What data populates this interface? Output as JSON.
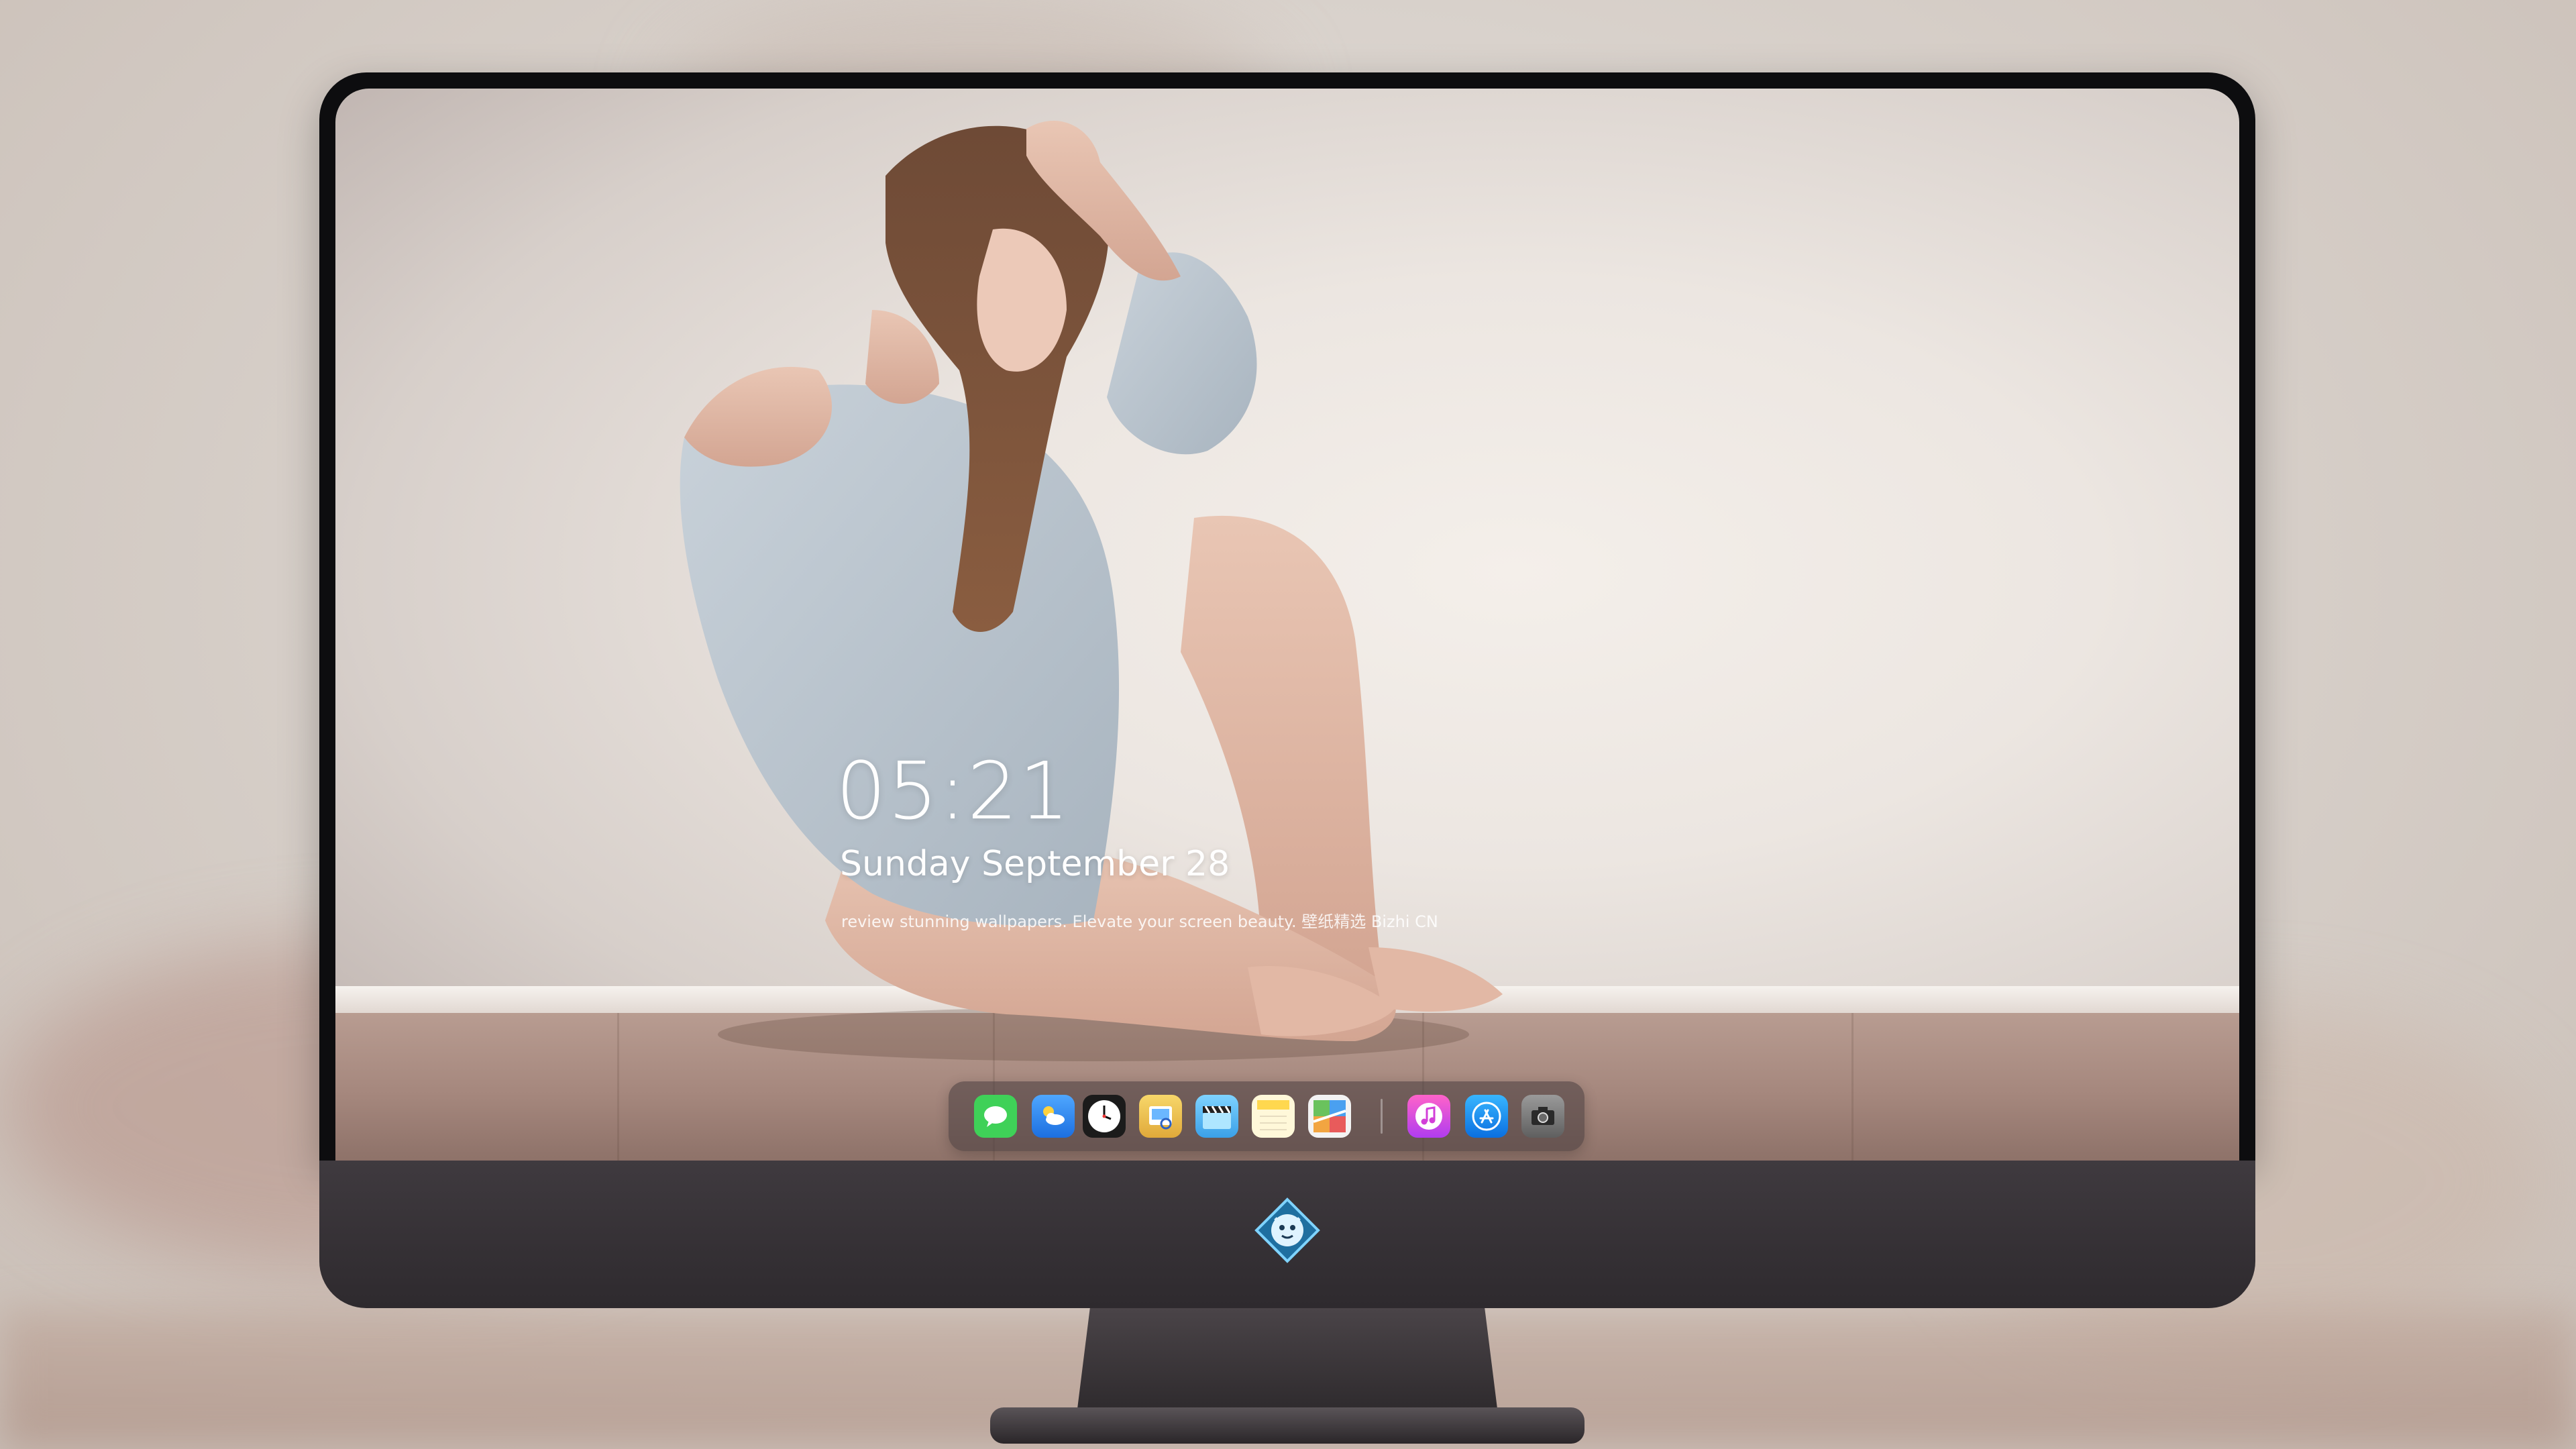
{
  "lockscreen": {
    "time": "05:21",
    "date": "Sunday September  28",
    "promo": "review stunning wallpapers. Elevate your screen beauty. 壁纸精选 Bizhi CN"
  },
  "dock": {
    "items": [
      {
        "icon": "messages-icon",
        "color": "#3fd158"
      },
      {
        "icon": "weather-icon",
        "color": "#2d8cf0"
      },
      {
        "icon": "clock-icon",
        "color": "#1b1b1b"
      },
      {
        "icon": "preview-icon",
        "color": "#f2c14a"
      },
      {
        "icon": "clapper-icon",
        "color": "#42a8f2"
      },
      {
        "icon": "notes-icon",
        "color": "#ffd84f"
      },
      {
        "icon": "maps-icon",
        "color": "#6ac25d"
      },
      {
        "icon": "music-icon",
        "color": "#e64ae0"
      },
      {
        "icon": "app-store-icon",
        "color": "#1e9bff"
      },
      {
        "icon": "camera-icon",
        "color": "#8a8a8a"
      }
    ]
  },
  "colors": {
    "bezel": "#0d0d0f",
    "chin": "#3a353a",
    "dock_bg": "#463a3c"
  }
}
